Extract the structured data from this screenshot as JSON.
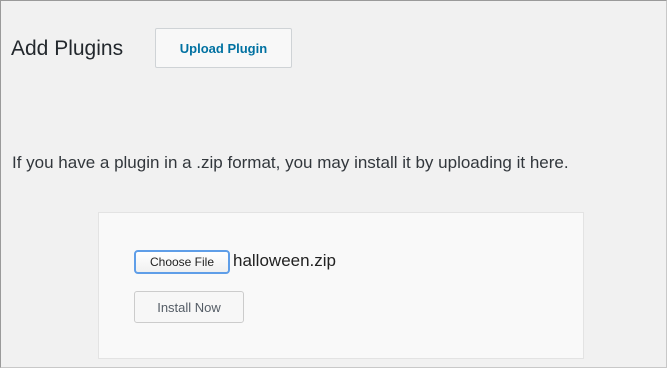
{
  "header": {
    "title": "Add Plugins",
    "upload_button_label": "Upload Plugin"
  },
  "upload_section": {
    "help_text": "If you have a plugin in a .zip format, you may install it by uploading it here.",
    "choose_file_label": "Choose File",
    "selected_file": "halloween.zip",
    "install_button_label": "Install Now"
  },
  "colors": {
    "background": "#f1f1f1",
    "link_blue": "#0071a1",
    "focus_ring": "#5f9ee8",
    "text": "#23282d"
  }
}
